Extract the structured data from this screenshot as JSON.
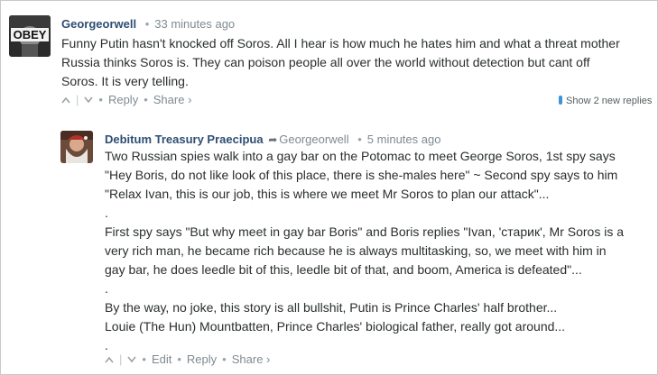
{
  "comments": [
    {
      "author": "Georgeorwell",
      "time": "33 minutes ago",
      "avatar_icon": "obey-poster-avatar",
      "body_lines": [
        "Funny Putin hasn't knocked off Soros. All I hear is how much he hates him and what a threat mother",
        "Russia thinks Soros is. They can poison people all over the world without detection but cant off",
        "Soros. It is very telling."
      ],
      "actions": {
        "upvote": "^",
        "downvote": "v",
        "reply": "Reply",
        "share": "Share ›"
      },
      "show_replies": "Show 2 new replies"
    },
    {
      "author": "Debitum Treasury Praecipua",
      "reply_to": "Georgeorwell",
      "time": "5 minutes ago",
      "avatar_icon": "santa-avatar",
      "body_lines": [
        "Two Russian spies walk into a gay bar on the Potomac to meet George Soros, 1st spy says",
        "\"Hey Boris, do not like look of this place, there is she-males here\" ~ Second spy says to him",
        "\"Relax Ivan, this is our job, this is where we meet Mr Soros to plan our attack\"...",
        ".",
        "First spy says \"But why meet in gay bar Boris\" and Boris replies \"Ivan, 'старик', Mr Soros is a",
        "very rich man, he became rich because he is always multitasking, so, we meet with him in",
        "gay bar, he does leedle bit of this, leedle bit of that, and boom, America is defeated\"...",
        ".",
        "By the way, no joke, this story is all bullshit, Putin is Prince Charles' half brother...",
        "Louie (The Hun) Mountbatten, Prince Charles' biological father, really got around...",
        "."
      ],
      "actions": {
        "upvote": "^",
        "downvote": "v",
        "edit": "Edit",
        "reply": "Reply",
        "share": "Share ›"
      }
    }
  ],
  "colors": {
    "author": "#2e4e73",
    "meta": "#7f8b91",
    "text": "#2a2e2e",
    "accent": "#3b93d8"
  }
}
